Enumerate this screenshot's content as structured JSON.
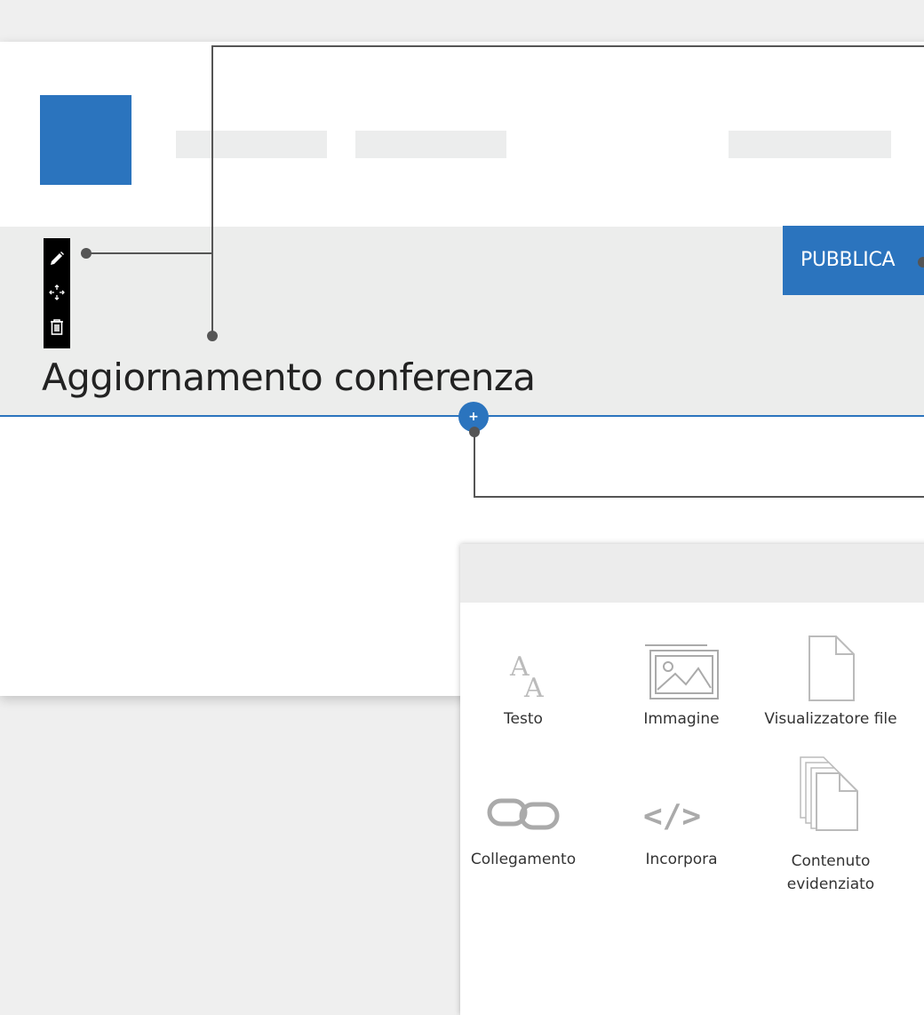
{
  "header": {
    "logo_color": "#2b74be",
    "placeholder_color": "#eceded"
  },
  "edit_toolbar": {
    "icons": [
      "pencil-icon",
      "move-icon",
      "trash-icon"
    ]
  },
  "publish_button": {
    "label": "PUBBLICA",
    "color": "#2b74be"
  },
  "page_title": "Aggiornamento conferenza",
  "add_section_button": {
    "label": "+"
  },
  "insert_panel": {
    "tiles": [
      {
        "label": "Testo",
        "icon": "text-icon"
      },
      {
        "label": "Immagine",
        "icon": "image-icon"
      },
      {
        "label": "Visualizzatore file",
        "icon": "document-icon"
      },
      {
        "label": "Collegamento",
        "icon": "link-icon"
      },
      {
        "label": "Incorpora",
        "icon": "code-icon"
      },
      {
        "label": "Contenuto evidenziato",
        "icon": "stacked-documents-icon"
      }
    ]
  },
  "colors": {
    "accent": "#2b74be",
    "band": "#ecedec",
    "background": "#efefef"
  }
}
